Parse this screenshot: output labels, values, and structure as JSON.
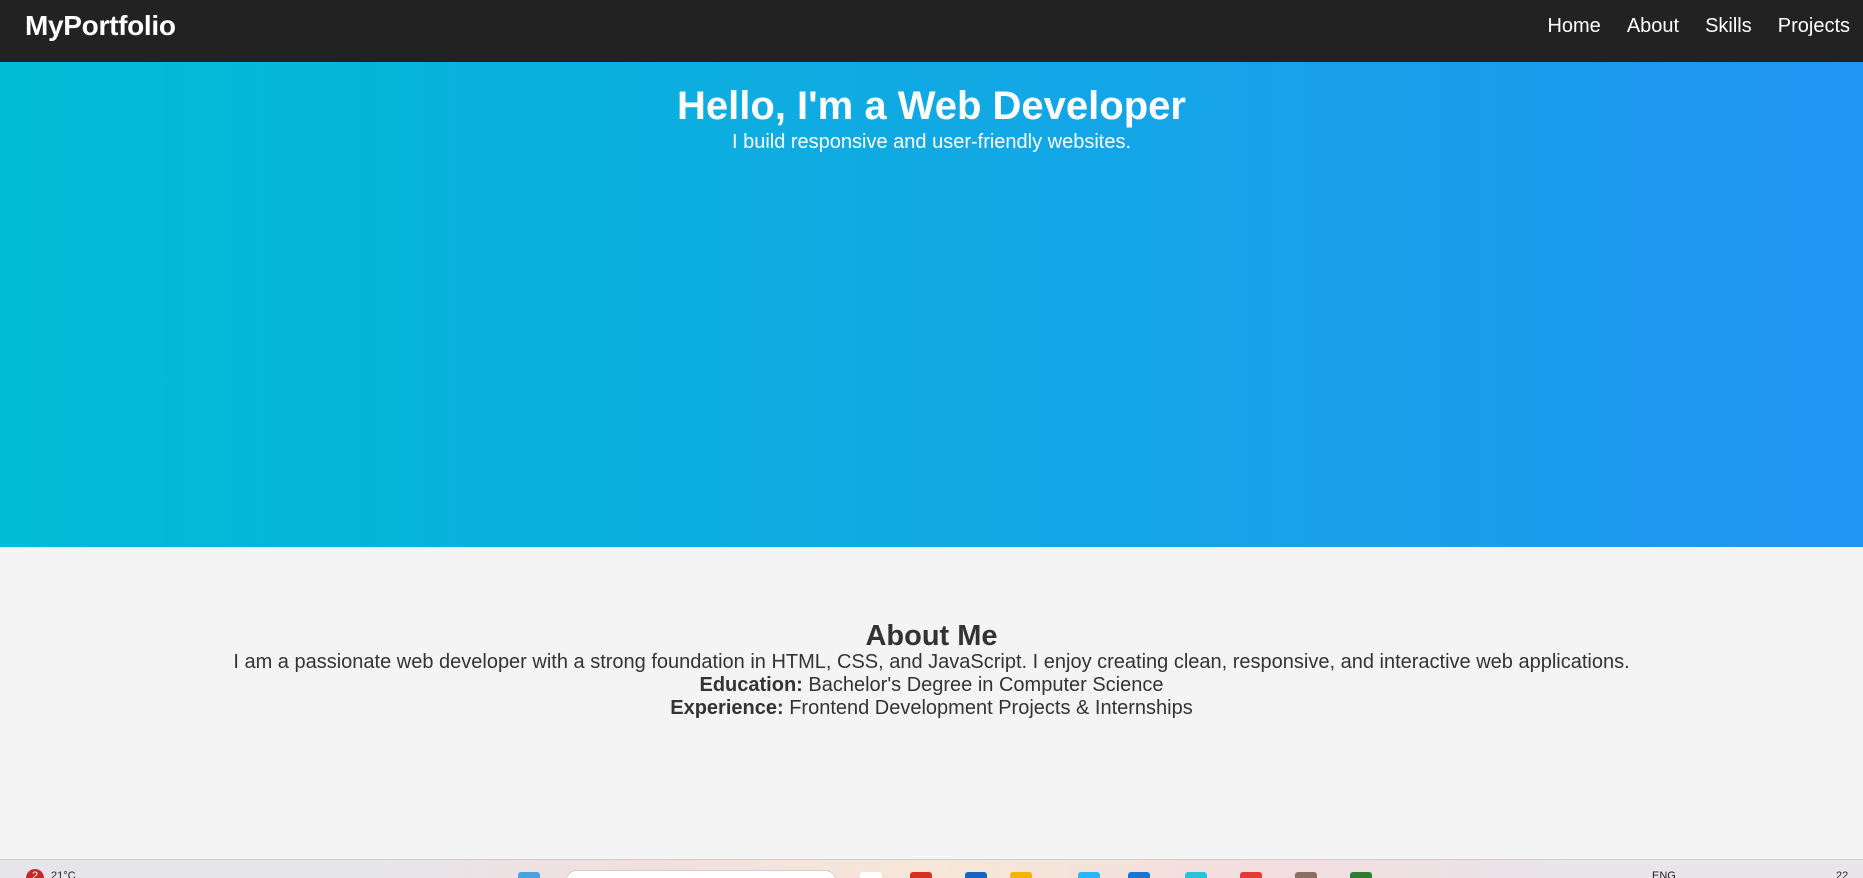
{
  "navbar": {
    "brand": "MyPortfolio",
    "links": [
      "Home",
      "About",
      "Skills",
      "Projects"
    ]
  },
  "hero": {
    "title": "Hello, I'm a Web Developer",
    "subtitle": "I build responsive and user-friendly websites.",
    "gradient_start": "#00bcd4",
    "gradient_end": "#2196f3"
  },
  "about": {
    "title": "About Me",
    "description": "I am a passionate web developer with a strong foundation in HTML, CSS, and JavaScript. I enjoy creating clean, responsive, and interactive web applications.",
    "education_label": "Education:",
    "education_value": " Bachelor's Degree in Computer Science",
    "experience_label": "Experience:",
    "experience_value": " Frontend Development Projects & Internships"
  },
  "taskbar": {
    "weather_badge": "2",
    "weather_temp": "21°C",
    "language": "ENG",
    "time": "22"
  },
  "colors": {
    "navbar_bg": "#222222",
    "section_bg": "#f4f4f4",
    "text_dark": "#333333"
  }
}
